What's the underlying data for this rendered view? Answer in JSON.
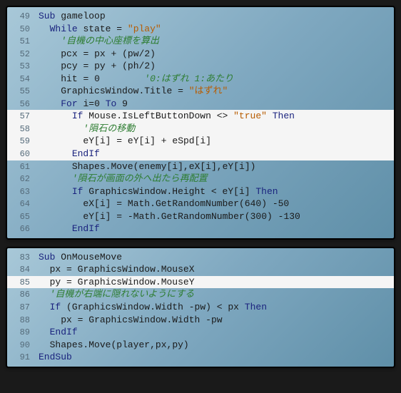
{
  "block1": {
    "lines": [
      {
        "n": 49,
        "hl": false,
        "tokens": [
          {
            "t": "kw",
            "v": "Sub"
          },
          {
            "t": "sp",
            "v": " "
          },
          {
            "t": "ident",
            "v": "gameloop"
          }
        ],
        "indent": 0
      },
      {
        "n": 50,
        "hl": false,
        "tokens": [
          {
            "t": "kw",
            "v": "While"
          },
          {
            "t": "sp",
            "v": " "
          },
          {
            "t": "ident",
            "v": "state"
          },
          {
            "t": "sp",
            "v": " "
          },
          {
            "t": "op",
            "v": "="
          },
          {
            "t": "sp",
            "v": " "
          },
          {
            "t": "str",
            "v": "\"play\""
          }
        ],
        "indent": 1
      },
      {
        "n": 51,
        "hl": false,
        "tokens": [
          {
            "t": "cmt",
            "v": "'自機の中心座標を算出"
          }
        ],
        "indent": 2
      },
      {
        "n": 52,
        "hl": false,
        "tokens": [
          {
            "t": "ident",
            "v": "pcx"
          },
          {
            "t": "sp",
            "v": " "
          },
          {
            "t": "op",
            "v": "="
          },
          {
            "t": "sp",
            "v": " "
          },
          {
            "t": "ident",
            "v": "px"
          },
          {
            "t": "sp",
            "v": " "
          },
          {
            "t": "op",
            "v": "+"
          },
          {
            "t": "sp",
            "v": " "
          },
          {
            "t": "op",
            "v": "("
          },
          {
            "t": "ident",
            "v": "pw"
          },
          {
            "t": "op",
            "v": "/"
          },
          {
            "t": "num",
            "v": "2"
          },
          {
            "t": "op",
            "v": ")"
          }
        ],
        "indent": 2
      },
      {
        "n": 53,
        "hl": false,
        "tokens": [
          {
            "t": "ident",
            "v": "pcy"
          },
          {
            "t": "sp",
            "v": " "
          },
          {
            "t": "op",
            "v": "="
          },
          {
            "t": "sp",
            "v": " "
          },
          {
            "t": "ident",
            "v": "py"
          },
          {
            "t": "sp",
            "v": " "
          },
          {
            "t": "op",
            "v": "+"
          },
          {
            "t": "sp",
            "v": " "
          },
          {
            "t": "op",
            "v": "("
          },
          {
            "t": "ident",
            "v": "ph"
          },
          {
            "t": "op",
            "v": "/"
          },
          {
            "t": "num",
            "v": "2"
          },
          {
            "t": "op",
            "v": ")"
          }
        ],
        "indent": 2
      },
      {
        "n": 54,
        "hl": false,
        "tokens": [
          {
            "t": "ident",
            "v": "hit"
          },
          {
            "t": "sp",
            "v": " "
          },
          {
            "t": "op",
            "v": "="
          },
          {
            "t": "sp",
            "v": " "
          },
          {
            "t": "num",
            "v": "0"
          },
          {
            "t": "sp",
            "v": "        "
          },
          {
            "t": "cmt",
            "v": "'0:はずれ 1:あたり"
          }
        ],
        "indent": 2
      },
      {
        "n": 55,
        "hl": false,
        "tokens": [
          {
            "t": "obj",
            "v": "GraphicsWindow"
          },
          {
            "t": "op",
            "v": "."
          },
          {
            "t": "ident",
            "v": "Title"
          },
          {
            "t": "sp",
            "v": " "
          },
          {
            "t": "op",
            "v": "="
          },
          {
            "t": "sp",
            "v": " "
          },
          {
            "t": "str",
            "v": "\"はずれ\""
          }
        ],
        "indent": 2
      },
      {
        "n": 56,
        "hl": false,
        "tokens": [
          {
            "t": "kw",
            "v": "For"
          },
          {
            "t": "sp",
            "v": " "
          },
          {
            "t": "ident",
            "v": "i"
          },
          {
            "t": "op",
            "v": "="
          },
          {
            "t": "num",
            "v": "0"
          },
          {
            "t": "sp",
            "v": " "
          },
          {
            "t": "kw",
            "v": "To"
          },
          {
            "t": "sp",
            "v": " "
          },
          {
            "t": "num",
            "v": "9"
          }
        ],
        "indent": 2
      },
      {
        "n": 57,
        "hl": true,
        "tokens": [
          {
            "t": "kw",
            "v": "If"
          },
          {
            "t": "sp",
            "v": " "
          },
          {
            "t": "obj",
            "v": "Mouse"
          },
          {
            "t": "op",
            "v": "."
          },
          {
            "t": "ident",
            "v": "IsLeftButtonDown"
          },
          {
            "t": "sp",
            "v": " "
          },
          {
            "t": "op",
            "v": "<>"
          },
          {
            "t": "sp",
            "v": " "
          },
          {
            "t": "str",
            "v": "\"true\""
          },
          {
            "t": "sp",
            "v": " "
          },
          {
            "t": "kw",
            "v": "Then"
          }
        ],
        "indent": 3
      },
      {
        "n": 58,
        "hl": true,
        "tokens": [
          {
            "t": "cmt",
            "v": "'隕石の移動"
          }
        ],
        "indent": 4
      },
      {
        "n": 59,
        "hl": true,
        "tokens": [
          {
            "t": "ident",
            "v": "eY"
          },
          {
            "t": "op",
            "v": "["
          },
          {
            "t": "ident",
            "v": "i"
          },
          {
            "t": "op",
            "v": "]"
          },
          {
            "t": "sp",
            "v": " "
          },
          {
            "t": "op",
            "v": "="
          },
          {
            "t": "sp",
            "v": " "
          },
          {
            "t": "ident",
            "v": "eY"
          },
          {
            "t": "op",
            "v": "["
          },
          {
            "t": "ident",
            "v": "i"
          },
          {
            "t": "op",
            "v": "]"
          },
          {
            "t": "sp",
            "v": " "
          },
          {
            "t": "op",
            "v": "+"
          },
          {
            "t": "sp",
            "v": " "
          },
          {
            "t": "ident",
            "v": "eSpd"
          },
          {
            "t": "op",
            "v": "["
          },
          {
            "t": "ident",
            "v": "i"
          },
          {
            "t": "op",
            "v": "]"
          }
        ],
        "indent": 4
      },
      {
        "n": 60,
        "hl": true,
        "tokens": [
          {
            "t": "kw",
            "v": "EndIf"
          }
        ],
        "indent": 3
      },
      {
        "n": 61,
        "hl": false,
        "tokens": [
          {
            "t": "obj",
            "v": "Shapes"
          },
          {
            "t": "op",
            "v": "."
          },
          {
            "t": "ident",
            "v": "Move"
          },
          {
            "t": "op",
            "v": "("
          },
          {
            "t": "ident",
            "v": "enemy"
          },
          {
            "t": "op",
            "v": "["
          },
          {
            "t": "ident",
            "v": "i"
          },
          {
            "t": "op",
            "v": "]"
          },
          {
            "t": "op",
            "v": ","
          },
          {
            "t": "ident",
            "v": "eX"
          },
          {
            "t": "op",
            "v": "["
          },
          {
            "t": "ident",
            "v": "i"
          },
          {
            "t": "op",
            "v": "]"
          },
          {
            "t": "op",
            "v": ","
          },
          {
            "t": "ident",
            "v": "eY"
          },
          {
            "t": "op",
            "v": "["
          },
          {
            "t": "ident",
            "v": "i"
          },
          {
            "t": "op",
            "v": "]"
          },
          {
            "t": "op",
            "v": ")"
          }
        ],
        "indent": 3
      },
      {
        "n": 62,
        "hl": false,
        "tokens": [
          {
            "t": "cmt",
            "v": "'隕石が画面の外へ出たら再配置"
          }
        ],
        "indent": 3
      },
      {
        "n": 63,
        "hl": false,
        "tokens": [
          {
            "t": "kw",
            "v": "If"
          },
          {
            "t": "sp",
            "v": " "
          },
          {
            "t": "obj",
            "v": "GraphicsWindow"
          },
          {
            "t": "op",
            "v": "."
          },
          {
            "t": "ident",
            "v": "Height"
          },
          {
            "t": "sp",
            "v": " "
          },
          {
            "t": "op",
            "v": "<"
          },
          {
            "t": "sp",
            "v": " "
          },
          {
            "t": "ident",
            "v": "eY"
          },
          {
            "t": "op",
            "v": "["
          },
          {
            "t": "ident",
            "v": "i"
          },
          {
            "t": "op",
            "v": "]"
          },
          {
            "t": "sp",
            "v": " "
          },
          {
            "t": "kw",
            "v": "Then"
          }
        ],
        "indent": 3
      },
      {
        "n": 64,
        "hl": false,
        "tokens": [
          {
            "t": "ident",
            "v": "eX"
          },
          {
            "t": "op",
            "v": "["
          },
          {
            "t": "ident",
            "v": "i"
          },
          {
            "t": "op",
            "v": "]"
          },
          {
            "t": "sp",
            "v": " "
          },
          {
            "t": "op",
            "v": "="
          },
          {
            "t": "sp",
            "v": " "
          },
          {
            "t": "obj",
            "v": "Math"
          },
          {
            "t": "op",
            "v": "."
          },
          {
            "t": "ident",
            "v": "GetRandomNumber"
          },
          {
            "t": "op",
            "v": "("
          },
          {
            "t": "num",
            "v": "640"
          },
          {
            "t": "op",
            "v": ")"
          },
          {
            "t": "sp",
            "v": " "
          },
          {
            "t": "op",
            "v": "-"
          },
          {
            "t": "num",
            "v": "50"
          }
        ],
        "indent": 4
      },
      {
        "n": 65,
        "hl": false,
        "tokens": [
          {
            "t": "ident",
            "v": "eY"
          },
          {
            "t": "op",
            "v": "["
          },
          {
            "t": "ident",
            "v": "i"
          },
          {
            "t": "op",
            "v": "]"
          },
          {
            "t": "sp",
            "v": " "
          },
          {
            "t": "op",
            "v": "="
          },
          {
            "t": "sp",
            "v": " "
          },
          {
            "t": "op",
            "v": "-"
          },
          {
            "t": "obj",
            "v": "Math"
          },
          {
            "t": "op",
            "v": "."
          },
          {
            "t": "ident",
            "v": "GetRandomNumber"
          },
          {
            "t": "op",
            "v": "("
          },
          {
            "t": "num",
            "v": "300"
          },
          {
            "t": "op",
            "v": ")"
          },
          {
            "t": "sp",
            "v": " "
          },
          {
            "t": "op",
            "v": "-"
          },
          {
            "t": "num",
            "v": "130"
          }
        ],
        "indent": 4
      },
      {
        "n": 66,
        "hl": false,
        "tokens": [
          {
            "t": "kw",
            "v": "EndIf"
          }
        ],
        "indent": 3
      }
    ]
  },
  "block2": {
    "lines": [
      {
        "n": 83,
        "hl": false,
        "tokens": [
          {
            "t": "kw",
            "v": "Sub"
          },
          {
            "t": "sp",
            "v": " "
          },
          {
            "t": "ident",
            "v": "OnMouseMove"
          }
        ],
        "indent": 0
      },
      {
        "n": 84,
        "hl": false,
        "tokens": [
          {
            "t": "ident",
            "v": "px"
          },
          {
            "t": "sp",
            "v": " "
          },
          {
            "t": "op",
            "v": "="
          },
          {
            "t": "sp",
            "v": " "
          },
          {
            "t": "obj",
            "v": "GraphicsWindow"
          },
          {
            "t": "op",
            "v": "."
          },
          {
            "t": "ident",
            "v": "MouseX"
          }
        ],
        "indent": 1
      },
      {
        "n": 85,
        "hl": true,
        "tokens": [
          {
            "t": "ident",
            "v": "py"
          },
          {
            "t": "sp",
            "v": " "
          },
          {
            "t": "op",
            "v": "="
          },
          {
            "t": "sp",
            "v": " "
          },
          {
            "t": "obj",
            "v": "GraphicsWindow"
          },
          {
            "t": "op",
            "v": "."
          },
          {
            "t": "ident",
            "v": "MouseY"
          }
        ],
        "indent": 1
      },
      {
        "n": 86,
        "hl": false,
        "tokens": [
          {
            "t": "cmt",
            "v": "'自機が右端に隠れないようにする"
          }
        ],
        "indent": 1
      },
      {
        "n": 87,
        "hl": false,
        "tokens": [
          {
            "t": "kw",
            "v": "If"
          },
          {
            "t": "sp",
            "v": " "
          },
          {
            "t": "op",
            "v": "("
          },
          {
            "t": "obj",
            "v": "GraphicsWindow"
          },
          {
            "t": "op",
            "v": "."
          },
          {
            "t": "ident",
            "v": "Width"
          },
          {
            "t": "sp",
            "v": " "
          },
          {
            "t": "op",
            "v": "-"
          },
          {
            "t": "ident",
            "v": "pw"
          },
          {
            "t": "op",
            "v": ")"
          },
          {
            "t": "sp",
            "v": " "
          },
          {
            "t": "op",
            "v": "<"
          },
          {
            "t": "sp",
            "v": " "
          },
          {
            "t": "ident",
            "v": "px"
          },
          {
            "t": "sp",
            "v": " "
          },
          {
            "t": "kw",
            "v": "Then"
          }
        ],
        "indent": 1
      },
      {
        "n": 88,
        "hl": false,
        "tokens": [
          {
            "t": "ident",
            "v": "px"
          },
          {
            "t": "sp",
            "v": " "
          },
          {
            "t": "op",
            "v": "="
          },
          {
            "t": "sp",
            "v": " "
          },
          {
            "t": "obj",
            "v": "GraphicsWindow"
          },
          {
            "t": "op",
            "v": "."
          },
          {
            "t": "ident",
            "v": "Width"
          },
          {
            "t": "sp",
            "v": " "
          },
          {
            "t": "op",
            "v": "-"
          },
          {
            "t": "ident",
            "v": "pw"
          }
        ],
        "indent": 2
      },
      {
        "n": 89,
        "hl": false,
        "tokens": [
          {
            "t": "kw",
            "v": "EndIf"
          }
        ],
        "indent": 1
      },
      {
        "n": 90,
        "hl": false,
        "tokens": [
          {
            "t": "obj",
            "v": "Shapes"
          },
          {
            "t": "op",
            "v": "."
          },
          {
            "t": "ident",
            "v": "Move"
          },
          {
            "t": "op",
            "v": "("
          },
          {
            "t": "ident",
            "v": "player"
          },
          {
            "t": "op",
            "v": ","
          },
          {
            "t": "ident",
            "v": "px"
          },
          {
            "t": "op",
            "v": ","
          },
          {
            "t": "ident",
            "v": "py"
          },
          {
            "t": "op",
            "v": ")"
          }
        ],
        "indent": 1
      },
      {
        "n": 91,
        "hl": false,
        "tokens": [
          {
            "t": "kw",
            "v": "EndSub"
          }
        ],
        "indent": 0
      }
    ]
  }
}
